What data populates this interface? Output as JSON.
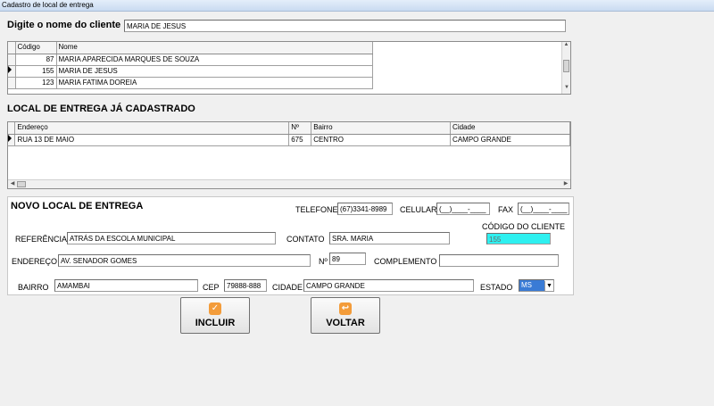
{
  "window": {
    "title": "Cadastro de local de entrega"
  },
  "search": {
    "label": "Digite o nome do cliente",
    "value": "MARIA DE JESUS"
  },
  "clients": {
    "headers": [
      "Código",
      "Nome"
    ],
    "rows": [
      {
        "codigo": "87",
        "nome": "MARIA APARECIDA MARQUES DE SOUZA",
        "current": false
      },
      {
        "codigo": "155",
        "nome": "MARIA DE JESUS",
        "current": true
      },
      {
        "codigo": "123",
        "nome": "MARIA FATIMA DOREIA",
        "current": false
      }
    ]
  },
  "registered": {
    "title": "LOCAL DE ENTREGA JÁ CADASTRADO",
    "headers": [
      "Endereço",
      "Nº",
      "Bairro",
      "Cidade"
    ],
    "rows": [
      {
        "endereco": "RUA 13 DE MAIO",
        "numero": "675",
        "bairro": "CENTRO",
        "cidade": "CAMPO GRANDE",
        "current": true
      }
    ]
  },
  "new": {
    "title": "NOVO LOCAL DE ENTREGA",
    "telefone": {
      "label": "TELEFONE",
      "value": "(67)3341-8989"
    },
    "celular": {
      "label": "CELULAR",
      "value": "(__)____-____"
    },
    "fax": {
      "label": "FAX",
      "value": "(__)____-____"
    },
    "codigo_cliente": {
      "label": "CÓDIGO DO CLIENTE",
      "value": "155"
    },
    "referencia": {
      "label": "REFERÊNCIA",
      "value": "ATRÁS DA ESCOLA MUNICIPAL"
    },
    "contato": {
      "label": "CONTATO",
      "value": "SRA. MARIA"
    },
    "endereco": {
      "label": "ENDEREÇO",
      "value": "AV. SENADOR GOMES"
    },
    "numero": {
      "label": "Nº",
      "value": "89"
    },
    "complemento": {
      "label": "COMPLEMENTO",
      "value": ""
    },
    "bairro": {
      "label": "BAIRRO",
      "value": "AMAMBAI"
    },
    "cep": {
      "label": "CEP",
      "value": "79888-888"
    },
    "cidade": {
      "label": "CIDADE",
      "value": "CAMPO GRANDE"
    },
    "estado": {
      "label": "ESTADO",
      "value": "MS"
    }
  },
  "buttons": {
    "incluir": {
      "label": "INCLUIR",
      "icon": "check-icon"
    },
    "voltar": {
      "label": "VOLTAR",
      "icon": "return-arrow-icon"
    }
  },
  "colors": {
    "codigo_bg": "#2ef0f0",
    "estado_bg": "#3a7bd5"
  }
}
